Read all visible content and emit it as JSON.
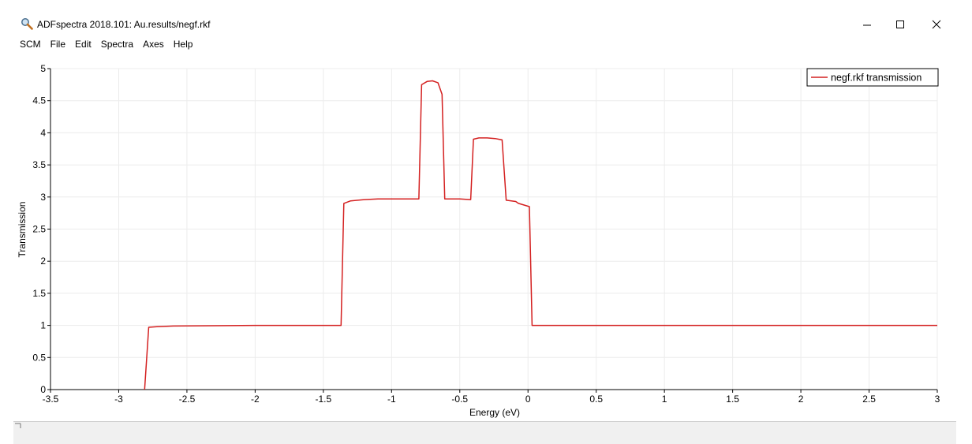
{
  "window": {
    "title": "ADFspectra 2018.101: Au.results/negf.rkf",
    "icon": "magnifier-icon"
  },
  "menu": {
    "items": [
      "SCM",
      "File",
      "Edit",
      "Spectra",
      "Axes",
      "Help"
    ]
  },
  "chart_data": {
    "type": "line",
    "xlabel": "Energy (eV)",
    "ylabel": "Transmission",
    "xlim": [
      -3.5,
      3
    ],
    "ylim": [
      0,
      5
    ],
    "xticks": [
      -3.5,
      -3,
      -2.5,
      -2,
      -1.5,
      -1,
      -0.5,
      0,
      0.5,
      1,
      1.5,
      2,
      2.5,
      3
    ],
    "xtick_labels": [
      "-3.5",
      "-3",
      "-2.5",
      "-2",
      "-1.5",
      "-1",
      "-0.5",
      "0",
      "0.5",
      "1",
      "1.5",
      "2",
      "2.5",
      "3"
    ],
    "yticks": [
      0,
      0.5,
      1,
      1.5,
      2,
      2.5,
      3,
      3.5,
      4,
      4.5,
      5
    ],
    "ytick_labels": [
      "0",
      "0.5",
      "1",
      "1.5",
      "2",
      "2.5",
      "3",
      "3.5",
      "4",
      "4.5",
      "5"
    ],
    "grid": true,
    "legend_position": "top-right",
    "series": [
      {
        "name": "negf.rkf transmission",
        "color": "#d42020",
        "x": [
          -2.81,
          -2.78,
          -2.72,
          -2.6,
          -2.0,
          -1.5,
          -1.37,
          -1.35,
          -1.3,
          -1.2,
          -1.1,
          -1.0,
          -0.9,
          -0.8,
          -0.78,
          -0.74,
          -0.7,
          -0.66,
          -0.63,
          -0.61,
          -0.5,
          -0.42,
          -0.4,
          -0.36,
          -0.3,
          -0.24,
          -0.19,
          -0.16,
          -0.09,
          -0.07,
          0.01,
          0.03,
          0.1,
          0.5,
          1.0,
          2.0,
          3.0
        ],
        "y": [
          0.0,
          0.97,
          0.98,
          0.99,
          1.0,
          1.0,
          1.0,
          2.9,
          2.94,
          2.96,
          2.97,
          2.97,
          2.97,
          2.97,
          4.75,
          4.8,
          4.81,
          4.78,
          4.6,
          2.97,
          2.97,
          2.96,
          3.9,
          3.92,
          3.92,
          3.91,
          3.89,
          2.95,
          2.93,
          2.9,
          2.85,
          1.0,
          1.0,
          1.0,
          1.0,
          1.0,
          1.0
        ]
      }
    ]
  }
}
